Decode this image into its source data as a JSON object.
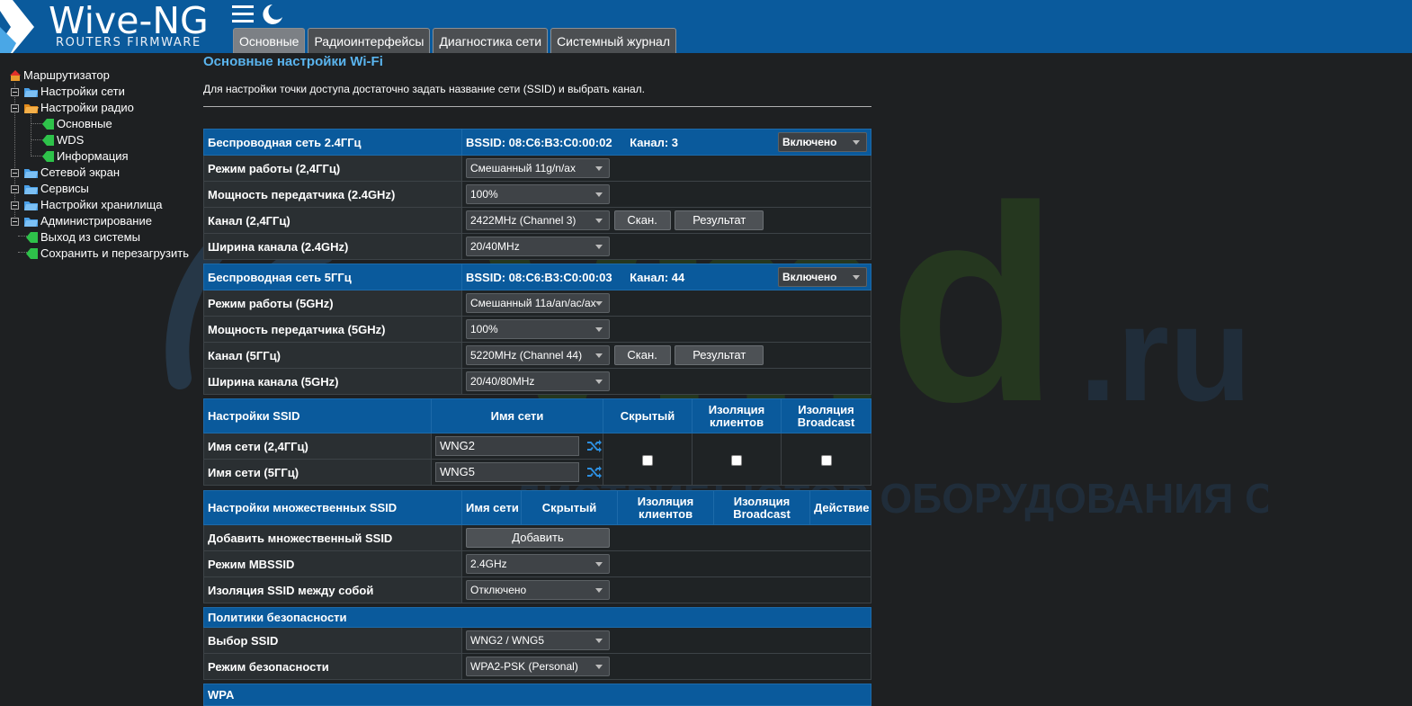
{
  "header": {
    "logo_title": "Wive-NG",
    "logo_subtitle": "ROUTERS FIRMWARE",
    "tabs": [
      {
        "label": "Основные",
        "active": true
      },
      {
        "label": "Радиоинтерфейсы",
        "active": false
      },
      {
        "label": "Диагностика сети",
        "active": false
      },
      {
        "label": "Системный журнал",
        "active": false
      }
    ]
  },
  "sidebar": {
    "root": "Маршрутизатор",
    "items": [
      {
        "label": "Настройки сети"
      },
      {
        "label": "Настройки радио"
      },
      {
        "label": "Основные"
      },
      {
        "label": "WDS"
      },
      {
        "label": "Информация"
      },
      {
        "label": "Сетевой экран"
      },
      {
        "label": "Сервисы"
      },
      {
        "label": "Настройки хранилища"
      },
      {
        "label": "Администрирование"
      },
      {
        "label": "Выход из системы"
      },
      {
        "label": "Сохранить и перезагрузить"
      }
    ]
  },
  "watermark": {
    "brand": "vmd",
    "tld": ".ru",
    "tagline": "ДИСТРИБЬЮТОР ОБОРУДОВАНИЯ СВЯЗИ"
  },
  "colors": {
    "accent": "#0a5a9c",
    "title": "#5ab4ee",
    "background": "#1e2022"
  },
  "page": {
    "title": "Основные настройки Wi-Fi",
    "description": "Для настройки точки доступа достаточно задать название сети (SSID) и выбрать канал."
  },
  "wifi24": {
    "header": "Беспроводная сеть 2.4ГГц",
    "bssid": "BSSID: 08:C6:B3:C0:00:02",
    "channel": "Канал: 3",
    "state": "Включено",
    "rows": [
      {
        "label": "Режим работы (2,4ГГц)",
        "value": "Смешанный 11g/n/ax"
      },
      {
        "label": "Мощность передатчика (2.4GHz)",
        "value": "100%"
      },
      {
        "label": "Канал (2,4ГГц)",
        "value": "2422MHz (Channel 3)"
      },
      {
        "label": "Ширина канала (2.4GHz)",
        "value": "20/40MHz"
      }
    ]
  },
  "wifi5": {
    "header": "Беспроводная сеть 5ГГц",
    "bssid": "BSSID: 08:C6:B3:C0:00:03",
    "channel": "Канал: 44",
    "state": "Включено",
    "rows": [
      {
        "label": "Режим работы (5GHz)",
        "value": "Смешанный 11a/an/ac/ax"
      },
      {
        "label": "Мощность передатчика (5GHz)",
        "value": "100%"
      },
      {
        "label": "Канал (5ГГц)",
        "value": "5220MHz (Channel 44)"
      },
      {
        "label": "Ширина канала (5GHz)",
        "value": "20/40/80MHz"
      }
    ]
  },
  "buttons": {
    "scan": "Скан.",
    "result": "Результат",
    "add": "Добавить"
  },
  "ssid": {
    "header": "Настройки SSID",
    "col_name": "Имя сети",
    "col_hidden": "Скрытый",
    "col_isolation_l1": "Изоляция",
    "col_isolation_l2": "клиентов",
    "col_broadcast_l1": "Изоляция",
    "col_broadcast_l2": "Broadcast",
    "row24_label": "Имя сети (2,4ГГц)",
    "row24_value": "WNG2",
    "row5_label": "Имя сети (5ГГц)",
    "row5_value": "WNG5"
  },
  "mbssid": {
    "header": "Настройки множественных SSID",
    "col_name": "Имя сети",
    "col_hidden": "Скрытый",
    "col_isolation_l1": "Изоляция",
    "col_isolation_l2": "клиентов",
    "col_broadcast_l1": "Изоляция",
    "col_broadcast_l2": "Broadcast",
    "col_action": "Действие",
    "add_label": "Добавить множественный SSID",
    "mode_label": "Режим MBSSID",
    "mode_value": "2.4GHz",
    "isolation_label": "Изоляция SSID между собой",
    "isolation_value": "Отключено"
  },
  "security": {
    "header": "Политики безопасности",
    "ssid_label": "Выбор SSID",
    "ssid_value": "WNG2 / WNG5",
    "mode_label": "Режим безопасности",
    "mode_value": "WPA2-PSK (Personal)"
  },
  "wpa": {
    "header": "WPA"
  }
}
